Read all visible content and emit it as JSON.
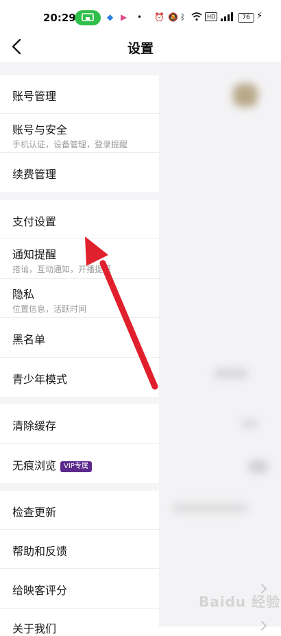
{
  "status_bar": {
    "time": "20:29",
    "battery": "76"
  },
  "header": {
    "title": "设置"
  },
  "groups": [
    {
      "items": [
        {
          "label": "账号管理"
        },
        {
          "label": "账号与安全",
          "subtitle": "手机认证，设备管理，登录提醒"
        },
        {
          "label": "续费管理"
        }
      ]
    },
    {
      "items": [
        {
          "label": "支付设置"
        },
        {
          "label": "通知提醒",
          "subtitle": "搭讪，互动通知，开播提醒"
        },
        {
          "label": "隐私",
          "subtitle": "位置信息，活跃时间"
        },
        {
          "label": "黑名单"
        },
        {
          "label": "青少年模式"
        }
      ]
    },
    {
      "items": [
        {
          "label": "清除缓存"
        },
        {
          "label": "无痕浏览",
          "badge": "VIP专属"
        }
      ]
    },
    {
      "items": [
        {
          "label": "检查更新"
        },
        {
          "label": "帮助和反馈"
        },
        {
          "label": "给映客评分"
        },
        {
          "label": "关于我们"
        }
      ]
    }
  ],
  "watermark": {
    "text": "Baidu 经验"
  },
  "colors": {
    "annotation_arrow": "#e0202c",
    "vip_badge": "#5b2a8c",
    "cast_pill": "#2fbf4a"
  }
}
